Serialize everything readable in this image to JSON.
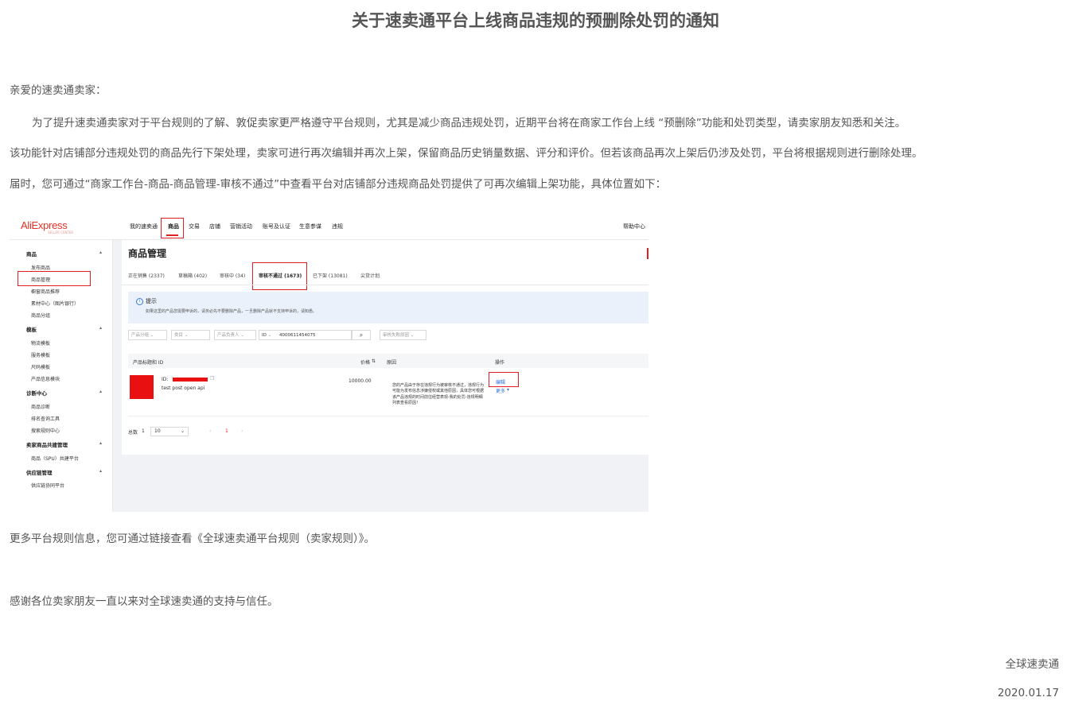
{
  "title": "关于速卖通平台上线商品违规的预删除处罚的通知",
  "greeting": "亲爱的速卖通卖家：",
  "para1": "为了提升速卖通卖家对于平台规则的了解、敦促卖家更严格遵守平台规则，尤其是减少商品违规处罚，近期平台将在商家工作台上线 “预删除”功能和处罚类型，请卖家朋友知悉和关注。",
  "para2": "该功能针对店铺部分违规处罚的商品先行下架处理，卖家可进行再次编辑并再次上架，保留商品历史销量数据、评分和评价。但若该商品再次上架后仍涉及处罚，平台将根据规则进行删除处理。",
  "para3": "届时，您可通过“商家工作台-商品-商品管理-审核不通过”中查看平台对店铺部分违规商品处罚提供了可再次编辑上架功能，具体位置如下：",
  "para4": "更多平台规则信息，您可通过链接查看《全球速卖通平台规则（卖家规则）》。",
  "thanks": "感谢各位卖家朋友一直以来对全球速卖通的支持与信任。",
  "signature": "全球速卖通",
  "date": "2020.01.17",
  "screenshot": {
    "logo": "AliExpress",
    "logo_sub": "SELLER CENTER",
    "nav": [
      "我的速卖通",
      "商品",
      "交易",
      "店铺",
      "营销活动",
      "账号及认证",
      "生意参谋",
      "违规"
    ],
    "help": "帮助中心",
    "sidebar": {
      "sections": [
        {
          "title": "商品",
          "items": [
            "发布商品",
            "商品管理",
            "橱窗商品推荐",
            "素材中心（图片银行）",
            "商品分组"
          ]
        },
        {
          "title": "模板",
          "items": [
            "物流模板",
            "服务模板",
            "尺码模板",
            "产品信息模块"
          ]
        },
        {
          "title": "诊断中心",
          "items": [
            "商品诊断",
            "排名查询工具",
            "搜索规则中心"
          ]
        },
        {
          "title": "卖家商品共建管理",
          "items": [
            "商品（SPU）共建平台"
          ]
        },
        {
          "title": "供应链管理",
          "items": [
            "供应链协同平台"
          ]
        }
      ]
    },
    "page_title": "商品管理",
    "tabs": [
      "正在销售 (2337)",
      "草稿箱 (402)",
      "审核中 (34)",
      "审核不通过 (1673)",
      "已下架 (13081)",
      "尖货计划"
    ],
    "tip_title": "提示",
    "tip_text": "如果这里的产品您需要申诉的，请务必先不要删除产品，一旦删除产品就不支持申诉的，请知悉。",
    "filters": {
      "group": "产品分组",
      "category": "类目",
      "owner": "产品负责人",
      "id_label": "ID",
      "id_value": "4000611454075",
      "reason": "审核失败原因"
    },
    "table": {
      "headers": [
        "产品标题和 ID",
        "价格",
        "原因",
        "操作"
      ],
      "rows": [
        {
          "id_label": "ID:",
          "title": "test post open api",
          "price": "10000.00",
          "reason": "您的产品由于存在违规行为被审核不通过，违规行为可能为发布信息涉嫌侵权或其他原因，具体您可根据该产品违规的时间前往经营表现-我的处罚-违规明细列表查看原因！",
          "edit": "编辑",
          "more": "更多"
        }
      ]
    },
    "pager": {
      "total_label": "总数",
      "total": "1",
      "page_size": "10",
      "current": "1"
    }
  }
}
